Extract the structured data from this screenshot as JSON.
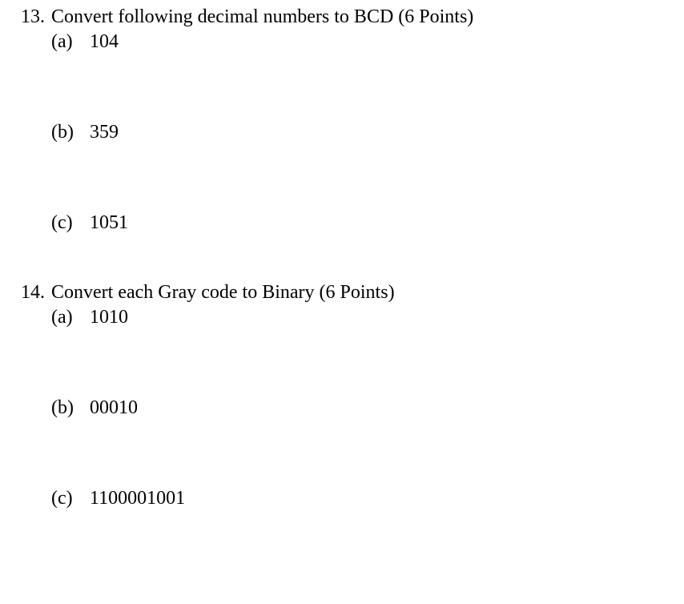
{
  "questions": [
    {
      "number": "13.",
      "text": "Convert following decimal numbers to BCD (6 Points)",
      "items": [
        {
          "label": "(a)",
          "value": "104"
        },
        {
          "label": "(b)",
          "value": "359"
        },
        {
          "label": "(c)",
          "value": "1051"
        }
      ]
    },
    {
      "number": "14.",
      "text": "Convert each Gray code to Binary (6 Points)",
      "items": [
        {
          "label": "(a)",
          "value": "1010"
        },
        {
          "label": "(b)",
          "value": "00010"
        },
        {
          "label": "(c)",
          "value": "1100001001"
        }
      ]
    }
  ]
}
